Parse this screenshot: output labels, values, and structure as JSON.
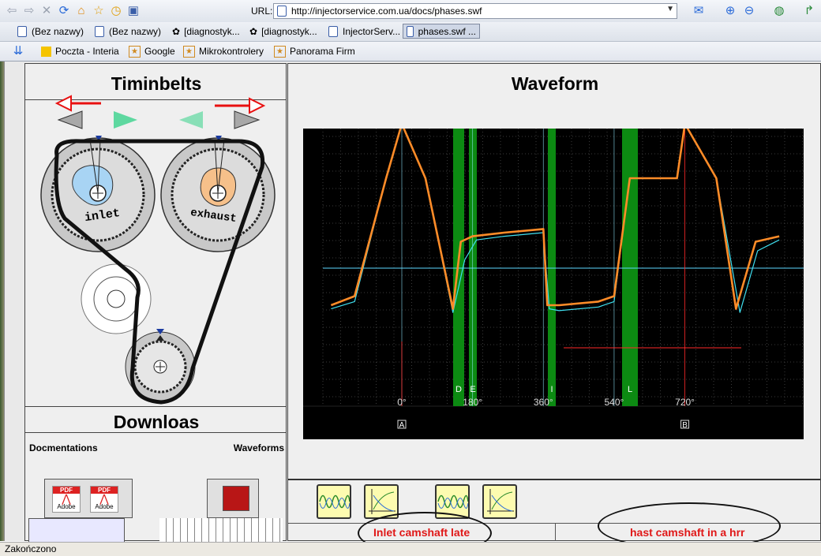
{
  "browser": {
    "url_label": "URL:",
    "url": "http://injectorservice.com.ua/docs/phases.swf",
    "tabs": [
      {
        "label": "(Bez nazwy)"
      },
      {
        "label": "(Bez nazwy)"
      },
      {
        "label": "[diagnostyk..."
      },
      {
        "label": "[diagnostyk..."
      },
      {
        "label": "InjectorServ..."
      },
      {
        "label": "phases.swf ..."
      }
    ],
    "bookmarks": [
      {
        "label": "Poczta - Interia"
      },
      {
        "label": "Google"
      },
      {
        "label": "Mikrokontrolery"
      },
      {
        "label": "Panorama Firm"
      }
    ],
    "status_text": "Zakończono"
  },
  "left_panel": {
    "title": "Timinbelts",
    "inlet_label": "inlet",
    "exhaust_label": "exhaust",
    "downloads_title": "Downloas",
    "docs_label": "Docmentations",
    "waveforms_label": "Waveforms",
    "pdf_label": "PDF",
    "adobe_label": "Adobe"
  },
  "right_panel": {
    "title": "Waveform",
    "left_status": "Inlet camshaft late",
    "right_status": "hast camshaft in a hrr"
  },
  "chart_data": {
    "type": "line",
    "title": "",
    "xlabel": "",
    "ylabel": "",
    "x_ticks": [
      "0°",
      "180°",
      "360°",
      "540°",
      "720°"
    ],
    "markers": [
      "D",
      "E",
      "I",
      "L"
    ],
    "cursor_labels": [
      "A",
      "B"
    ],
    "series": [
      {
        "color": "#ff8c28",
        "x": [
          -180,
          -120,
          -40,
          0,
          60,
          130,
          150,
          180,
          260,
          360,
          370,
          400,
          500,
          540,
          580,
          700,
          720,
          800,
          850,
          900,
          960
        ],
        "y": [
          0.2,
          0.25,
          0.9,
          1.2,
          0.9,
          0.18,
          0.55,
          0.58,
          0.6,
          0.62,
          0.2,
          0.2,
          0.22,
          0.25,
          0.9,
          0.9,
          1.2,
          0.9,
          0.18,
          0.55,
          0.58
        ]
      },
      {
        "color": "#40e0f0",
        "x": [
          -180,
          -120,
          -40,
          0,
          60,
          130,
          160,
          190,
          260,
          360,
          375,
          400,
          500,
          540,
          580,
          700,
          720,
          800,
          860,
          905,
          960
        ],
        "y": [
          0.18,
          0.22,
          0.9,
          1.2,
          0.9,
          0.16,
          0.45,
          0.56,
          0.58,
          0.6,
          0.18,
          0.17,
          0.19,
          0.22,
          0.9,
          0.9,
          1.2,
          0.9,
          0.16,
          0.5,
          0.56
        ]
      }
    ],
    "grid": true,
    "colors": {
      "background": "#000000",
      "grid": "#3a3a3a",
      "highlight": "#0c8a12",
      "reference": "#5bd8ff",
      "cursor_red": "#ff2a2a"
    }
  }
}
